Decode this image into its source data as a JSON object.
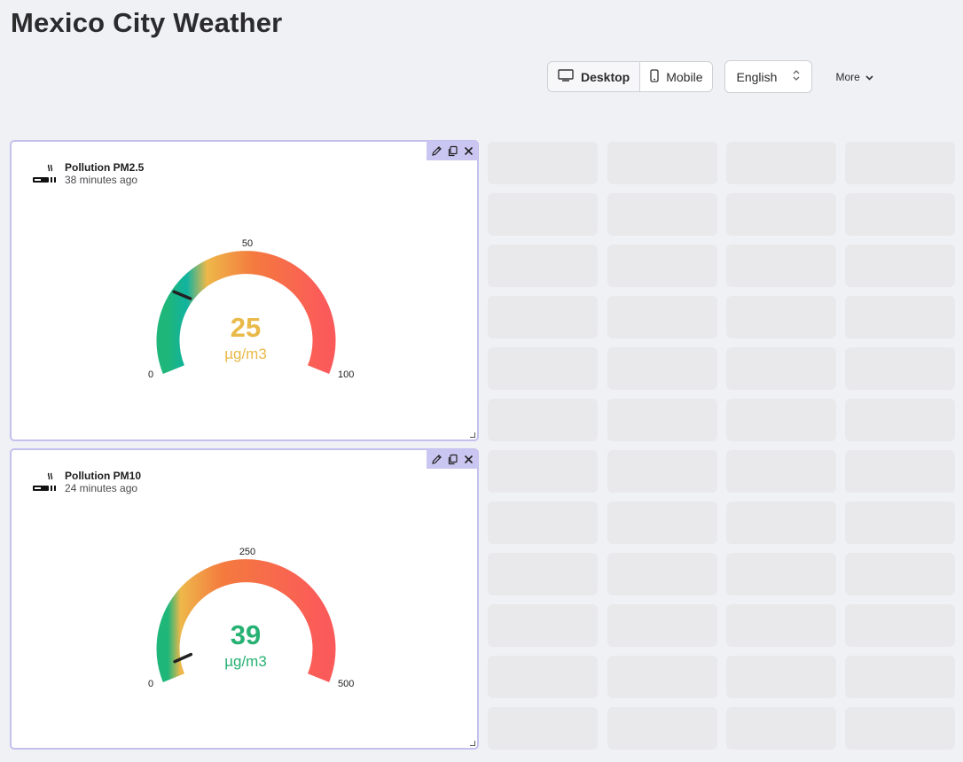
{
  "page": {
    "title": "Mexico City Weather"
  },
  "toolbar": {
    "desktop_label": "Desktop",
    "mobile_label": "Mobile",
    "language": "English",
    "more_label": "More"
  },
  "widgets": [
    {
      "title": "Pollution PM2.5",
      "updated": "38 minutes ago",
      "value": "25",
      "unit": "µg/m3",
      "min": "0",
      "mid": "50",
      "max": "100",
      "value_num": 25,
      "min_num": 0,
      "max_num": 100,
      "value_color": "#e9b949"
    },
    {
      "title": "Pollution PM10",
      "updated": "24 minutes ago",
      "value": "39",
      "unit": "µg/m3",
      "min": "0",
      "mid": "250",
      "max": "500",
      "value_num": 39,
      "min_num": 0,
      "max_num": 500,
      "value_color": "#27b173"
    }
  ],
  "colors": {
    "widget_border": "#c3c0ee",
    "controls_bg": "#c9c6f2",
    "placeholder": "#e9e9eb",
    "gauge_green": "#1fb67a",
    "gauge_yellow": "#eeb84a",
    "gauge_orange": "#f47a3e",
    "gauge_red": "#fb5a5a"
  }
}
